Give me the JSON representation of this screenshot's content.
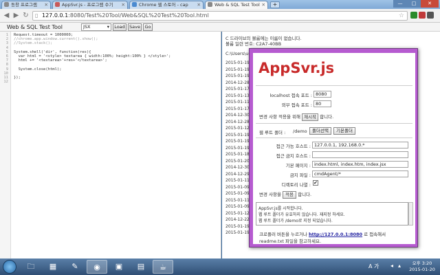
{
  "browser": {
    "tabs": [
      {
        "label": "동창 프로그램",
        "color": "#8a8a8a"
      },
      {
        "label": "AppSvr.js - 프로그램 수기",
        "color": "#c85a5a"
      },
      {
        "label": "Chrome 웹 스토어 - cap",
        "color": "#4a8ad0"
      },
      {
        "label": "Web & SQL Test Tool",
        "color": "#888888"
      }
    ],
    "new_tab_label": "+",
    "url_host": "127.0.0.1",
    "url_rest": ":8080/Test%20Tool/Web&SQL%20Test%20Tool.html",
    "window_buttons": [
      "—",
      "□",
      "✕"
    ]
  },
  "app": {
    "title": "Web & SQL Test Tool",
    "type_select": "JSX",
    "buttons": {
      "load": "Load",
      "save": "Save",
      "go": "Go"
    }
  },
  "editor": {
    "line_numbers": [
      "1",
      "2",
      "3",
      "4",
      "5",
      "6",
      "7",
      "8",
      "9",
      "10",
      "11",
      "12"
    ],
    "code_lines": [
      {
        "text": "Request.timeout = 1000000;",
        "comment": false
      },
      {
        "text": "//chrome.app.window.current().show();",
        "comment": true
      },
      {
        "text": "//System.stack();",
        "comment": true
      },
      {
        "text": "",
        "comment": false
      },
      {
        "text": "System.shell('dir', function(res){",
        "comment": false
      },
      {
        "text": "  var html = '<style> textarea { width:100%; height:100% } </style>';",
        "comment": false
      },
      {
        "text": "  html += '<textarea>'+res+'</textarea>';",
        "comment": false
      },
      {
        "text": "",
        "comment": false
      },
      {
        "text": "  System.close(html);",
        "comment": false
      },
      {
        "text": "",
        "comment": false
      },
      {
        "text": "});",
        "comment": false
      },
      {
        "text": "",
        "comment": false
      }
    ]
  },
  "console": {
    "header_lines": [
      "C 드라이브의 볼륨에는 이름이 없습니다.",
      "볼륨 일련 번호: C2A7-40BB",
      "",
      "C:\\Users\\user\\..."
    ],
    "dates": [
      "2015-01-19",
      "2015-01-19",
      "2015-01-19",
      "2014-12-28",
      "2015-01-17",
      "2015-01-13",
      "2015-01-11",
      "2015-01-17",
      "2014-12-30",
      "2014-12-28",
      "2015-01-12",
      "2015-01-19",
      "2015-01-19",
      "2015-01-19",
      "2015-01-18",
      "2015-01-20",
      "2014-12-30",
      "2014-12-29",
      "2015-01-11",
      "2015-01-09",
      "2015-01-09",
      "2015-01-11",
      "2015-01-09",
      "2015-01-12",
      "2014-12-22",
      "2015-01-19",
      "2015-01-19"
    ]
  },
  "dialog": {
    "logo": "AppSvr.js",
    "localhost_port_label": "localhost 접속 포트 :",
    "localhost_port_value": "8080",
    "external_port_label": "외부 접속 포트 :",
    "external_port_value": "80",
    "restart_text_before": "변경 사항 적용을 위해",
    "restart_text_button": "재시작",
    "restart_text_after": "합니다.",
    "web_root_label": "웹 루트 폴더 :",
    "web_root_value": "/demo",
    "folder_select_button": "폴더선택",
    "default_folder_button": "기본폴더",
    "allowed_hosts_label": "접근 가능 호스트 :",
    "allowed_hosts_value": "127.0.0.1, 192.168.0.*",
    "blocked_hosts_label": "접근 금지 호스트 :",
    "blocked_hosts_value": "",
    "default_pages_label": "기본 페이지 :",
    "default_pages_value": "index.html, index.htm, index.jsx",
    "forbidden_files_label": "금지 파일 :",
    "forbidden_files_value": "cmdAgent/*",
    "dir_listing_label": "디렉토리 나열 :",
    "dir_listing_checked": true,
    "apply_text_before": "변경 사항을",
    "apply_button": "적용",
    "apply_text_after": "합니다.",
    "log_lines": [
      "AppSvr.js를 시작합니다.",
      "웹 루트 폴더가 유효하지 않습니다. 재지정 하세요.",
      "웹 루트 폴더가 /demo로 지정 되었습니다."
    ],
    "footer_line1_before": "크로플러 버튼을 누르거나",
    "footer_link": "http://127.0.0.1:8080",
    "footer_line1_after": "로 접속해서",
    "footer_line2": "readme.txt 파일을 참고하세요."
  },
  "taskbar": {
    "lang_indicator": "A 가",
    "time": "오후 3:20",
    "date": "2015-01-20"
  }
}
